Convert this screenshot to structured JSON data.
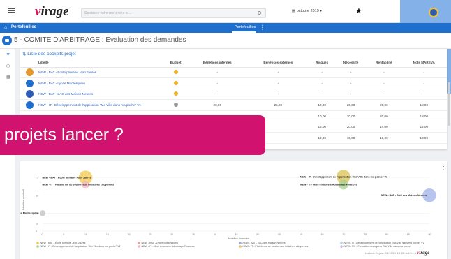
{
  "header": {
    "logo_v": "v",
    "logo_rest": "irage",
    "search_placeholder": "Saisissez votre recherche ici...",
    "date_selector": "octobre 2019",
    "nav_tab": "Portefeuilles",
    "breadcrumb": "Portefeuilles"
  },
  "page": {
    "title": "5 - COMITE D'ARBITRAGE : Évaluation des demandes"
  },
  "table": {
    "title": "Liste des cockpits projet",
    "columns": [
      "Libellé",
      "Budget",
      "Bénéfices internes",
      "Bénéfices externes",
      "Risques",
      "Nécessité",
      "Rentabilité",
      "Note MAREVA"
    ],
    "rows": [
      {
        "label": "NEW - BAT - École primaire Jean Jaurès",
        "icon": "o",
        "budget": "y",
        "vals": [
          "-",
          "-",
          "-",
          "-",
          "-",
          "-"
        ]
      },
      {
        "label": "NEW - BAT - Lycée Montesquieu",
        "icon": "b",
        "budget": "y",
        "vals": [
          "-",
          "-",
          "-",
          "-",
          "-",
          "-"
        ]
      },
      {
        "label": "NEW - BAT - ZAC des Maison Neuves",
        "icon": "d",
        "budget": "y",
        "vals": [
          "-",
          "-",
          "-",
          "-",
          "-",
          "-"
        ]
      },
      {
        "label": "NEW - IT - Développement de l'application \"Ma Ville dans ma poche\" V1",
        "icon": "b",
        "budget": "g",
        "vals": [
          "20,00",
          "25,00",
          "10,00",
          "20,00",
          "20,00",
          "18,00"
        ]
      },
      {
        "label": "",
        "icon": "",
        "budget": "",
        "vals": [
          "",
          "",
          "10,00",
          "20,00",
          "20,00",
          "18,00"
        ]
      },
      {
        "label": "",
        "icon": "",
        "budget": "",
        "vals": [
          "",
          "",
          "15,00",
          "20,00",
          "14,00",
          "14,00"
        ]
      },
      {
        "label": "",
        "icon": "",
        "budget": "",
        "vals": [
          "",
          "",
          "10,00",
          "15,00",
          "10,00",
          "13,00"
        ]
      }
    ]
  },
  "callout": "projets lancer ?",
  "chart_data": {
    "type": "scatter",
    "xlabel": "Bénéfice financier",
    "ylabel": "Bénéfice qualitatif",
    "xlim": [
      0,
      90
    ],
    "ylim": [
      0,
      80
    ],
    "xticks": [
      "0",
      "5",
      "10",
      "15",
      "20",
      "25",
      "30",
      "35",
      "40",
      "45",
      "50",
      "55",
      "60",
      "65",
      "70",
      "75",
      "80",
      "85",
      "90"
    ],
    "yticks": [
      "0",
      "10",
      "25",
      "50",
      "75"
    ],
    "points": [
      {
        "x": 10,
        "y": 75,
        "r": 7,
        "label": "NEW - BAT - École primaire Jean Jaurès",
        "color": "#f2c94c"
      },
      {
        "x": 10,
        "y": 65,
        "r": 4,
        "label": "NEW - IT - Plateforme de soutien aux initiatives citoyennes",
        "color": "#f5b8c4"
      },
      {
        "x": 70,
        "y": 76,
        "r": 7,
        "label": "NEW - IT - Développement de l'application \"Ma Ville dans ma poche\" V1",
        "color": "#d9c24f"
      },
      {
        "x": 70,
        "y": 65,
        "r": 5,
        "label": "NEW - IT - Mise en oeuvre Advantage Finances",
        "color": "#a9d08e"
      },
      {
        "x": 90,
        "y": 50,
        "r": 7,
        "label": "NEW - BAT - ZAC des Maison Neuves",
        "color": "#9fb1e8"
      },
      {
        "x": 0,
        "y": 25,
        "r": 3,
        "label": "NEW - BAT - Lycée Montesquieu",
        "color": "#bfbfbf"
      }
    ],
    "legend": [
      {
        "label": "NEW - BAT - École primaire Jean Jaurès",
        "color": "#f2c94c"
      },
      {
        "label": "NEW - IT - Développement de l'application \"Ma Ville dans ma poche\" V2",
        "color": "#a9d08e"
      },
      {
        "label": "NEW - BAT - Lycée Montesquieu",
        "color": "#e8a0a0"
      },
      {
        "label": "NEW - IT - Mise en oeuvre Advantage Finances",
        "color": "#f5b8c4"
      },
      {
        "label": "NEW - BAT - ZAC des Maison Neuves",
        "color": "#9fb1e8"
      },
      {
        "label": "NEW - IT - Plateforme de soutien aux initiatives citoyennes",
        "color": "#e8c26a"
      },
      {
        "label": "NEW - IT - Développement de l'application \"Ma Ville dans ma poche\" V1",
        "color": "#b0d7f0"
      },
      {
        "label": "NEW - RH - Formation des agents \"Ma Ville dans ma poche\"",
        "color": "#d2b4e6"
      }
    ]
  },
  "footer": {
    "text": "Ludovic Dejus - 05/10/19 10:30 - v5.3.1.0",
    "logo_v": "v",
    "logo_rest": "irage"
  }
}
